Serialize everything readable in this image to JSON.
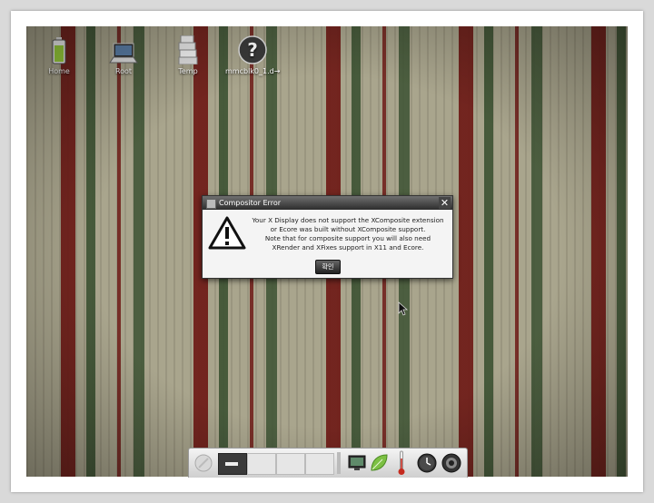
{
  "desktop": {
    "icons": [
      {
        "label": "Home",
        "icon": "battery-icon"
      },
      {
        "label": "Root",
        "icon": "laptop-icon"
      },
      {
        "label": "Temp",
        "icon": "stack-icon"
      },
      {
        "label": "mmcblk0_1.d→",
        "icon": "question-icon"
      }
    ]
  },
  "dialog": {
    "title": "Compositor Error",
    "line1": "Your X Display does not support the XComposite extension",
    "line2": "or Ecore was built without XComposite support.",
    "line3": "Note that for composite support you will also need",
    "line4": "XRender and XFixes support in X11 and Ecore.",
    "ok_label": "확인",
    "close_glyph": "✕"
  },
  "shelf": {
    "pager_cells": 4,
    "active_cell": 1,
    "items": [
      "start-icon",
      "pager",
      "display-icon",
      "leaf-icon",
      "thermometer-icon",
      "clock-icon",
      "speaker-icon"
    ]
  },
  "colors": {
    "stripe_red": "#6e1a16",
    "stripe_green": "#3c5232",
    "base": "#a9a58d"
  }
}
